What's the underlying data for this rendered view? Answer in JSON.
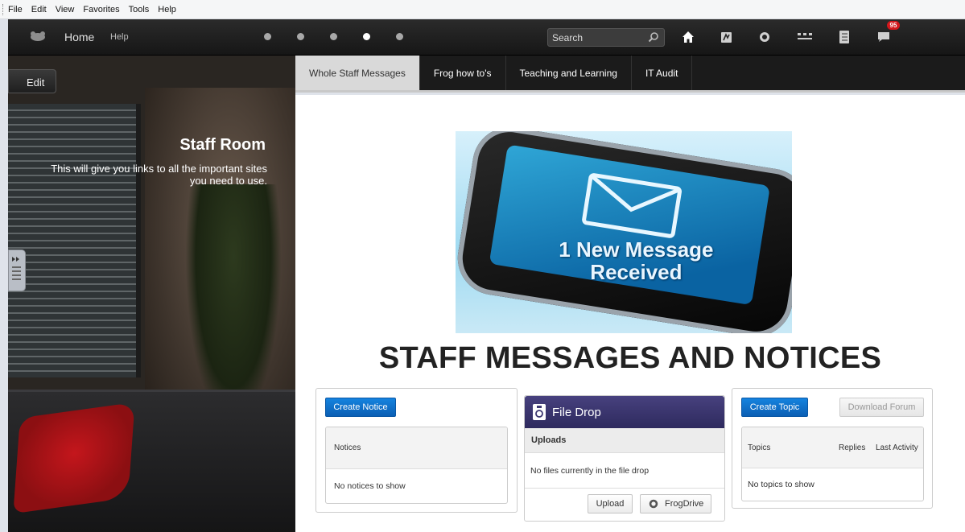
{
  "browser_menu": [
    "File",
    "Edit",
    "View",
    "Favorites",
    "Tools",
    "Help"
  ],
  "topbar": {
    "home_label": "Home",
    "help_label": "Help",
    "search_placeholder": "Search",
    "notification_count": "95",
    "icons": [
      "home-icon",
      "frog-drive-icon",
      "frogdrive-swirl-icon",
      "apps-icon",
      "notebook-icon",
      "messages-icon"
    ]
  },
  "leftpane": {
    "edit_label": "Edit",
    "title": "Staff Room",
    "description": "This will give you links to all the important sites you need to use."
  },
  "tabs": [
    {
      "label": "Whole Staff Messages",
      "active": true
    },
    {
      "label": "Frog how to's",
      "active": false
    },
    {
      "label": "Teaching and Learning",
      "active": false
    },
    {
      "label": "IT Audit",
      "active": false
    }
  ],
  "main": {
    "hero_text_line1": "1 New Message",
    "hero_text_line2": "Received",
    "heading": "STAFF MESSAGES AND NOTICES"
  },
  "notices": {
    "create_label": "Create Notice",
    "header": "Notices",
    "empty": "No notices to show"
  },
  "filedrop": {
    "title": "File Drop",
    "uploads_label": "Uploads",
    "empty": "No files currently in the file drop",
    "upload_label": "Upload",
    "frogdrive_label": "FrogDrive"
  },
  "forum": {
    "create_label": "Create Topic",
    "download_label": "Download Forum",
    "col_topics": "Topics",
    "col_replies": "Replies",
    "col_last": "Last Activity",
    "empty": "No topics to show"
  },
  "colors": {
    "accent_blue": "#0b5fb4",
    "filedrop_purple": "#3b3670",
    "badge_red": "#d4161b"
  }
}
